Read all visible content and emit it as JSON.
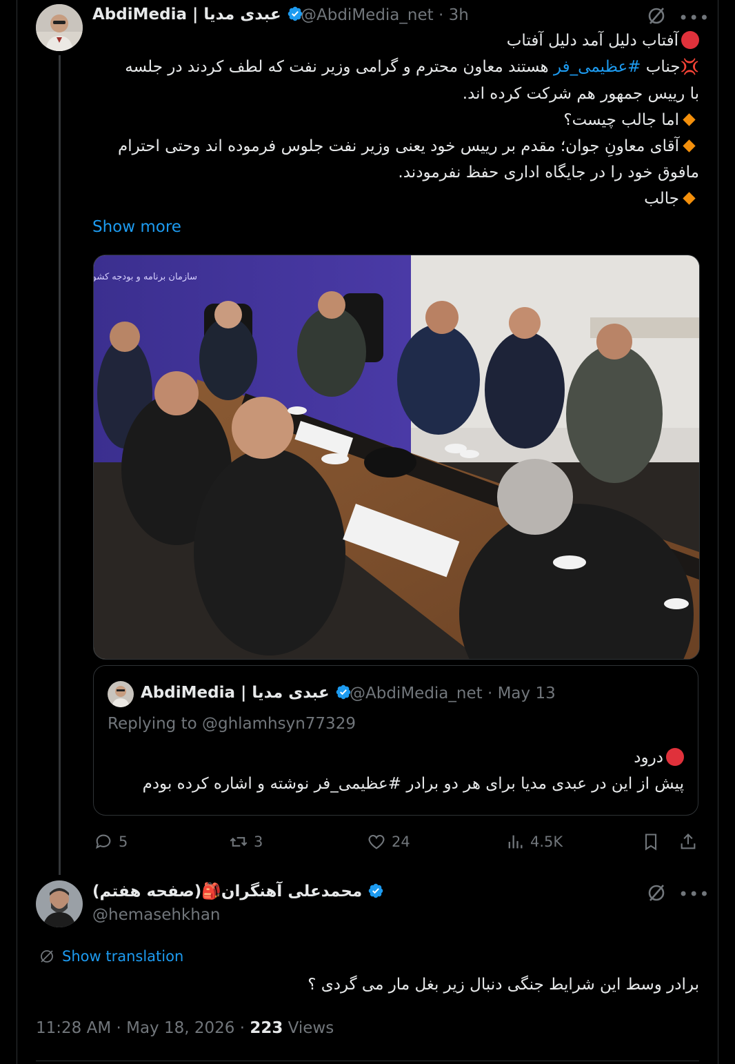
{
  "tweet": {
    "author_name": "AbdiMedia | عبدی مدیا",
    "handle_time": "@AbdiMedia_net · 3h",
    "lines": [
      "آفتاب دلیل آمد دلیل آفتاب",
      "جناب",
      "#عظیمی_فر",
      "هستند معاون محترم و گرامی وزیر نفت که لطف کردند در جلسه",
      "با رییس جمهور هم شرکت کرده اند.",
      "اما جالب چیست؟",
      "آقای معاونِ جوان؛ مقدم بر رییس خود یعنی وزیر نفت جلوس فرموده اند وحتی احترام",
      "مافوق خود را در جایگاه اداری حفظ نفرمودند.",
      "جالب"
    ],
    "show_more": "Show more",
    "media_caption": "سازمان برنامه و بودجه کشور",
    "quote": {
      "author_name": "AbdiMedia | عبدی مدیا",
      "handle_time": "@AbdiMedia_net · May 13",
      "replying_to": "Replying to @ghlamhsyn77329",
      "line1": "درود",
      "line2": "پیش از این در عبدی مدیا برای هر دو برادر #عظیمی_فر نوشته و اشاره کرده بودم"
    },
    "actions": {
      "replies": "5",
      "retweets": "3",
      "likes": "24",
      "views": "4.5K"
    }
  },
  "reply": {
    "author_name": "محمدعلی آهنگران🎒(صفحه هفتم)",
    "handle": "@hemasehkhan",
    "show_translation": "Show translation",
    "text": "برادر وسط این شرایط جنگی دنبال زیر بغل مار می گردی ؟",
    "time": "11:28 AM · May 18, 2026 · ",
    "views_count": "223",
    "views_label": " Views"
  },
  "colors": {
    "accent": "#1d9bf0",
    "muted": "#71767b",
    "text": "#e7e9ea",
    "border": "#2f3336",
    "verified": "#1d9bf0",
    "red_dot": "#e0313b"
  }
}
